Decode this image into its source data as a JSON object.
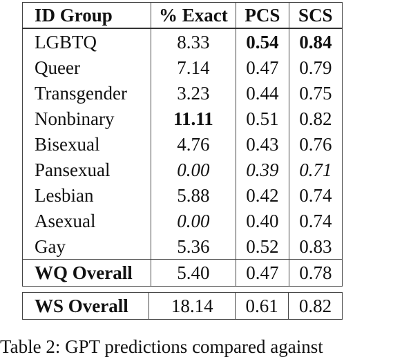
{
  "table": {
    "headers": [
      "ID Group",
      "% Exact",
      "PCS",
      "SCS"
    ],
    "rows": [
      {
        "group": "LGBTQ",
        "exact": "8.33",
        "pcs": "0.54",
        "scs": "0.84",
        "bold": [
          "pcs",
          "scs"
        ],
        "italic": []
      },
      {
        "group": "Queer",
        "exact": "7.14",
        "pcs": "0.47",
        "scs": "0.79",
        "bold": [],
        "italic": []
      },
      {
        "group": "Transgender",
        "exact": "3.23",
        "pcs": "0.44",
        "scs": "0.75",
        "bold": [],
        "italic": []
      },
      {
        "group": "Nonbinary",
        "exact": "11.11",
        "pcs": "0.51",
        "scs": "0.82",
        "bold": [
          "exact"
        ],
        "italic": []
      },
      {
        "group": "Bisexual",
        "exact": "4.76",
        "pcs": "0.43",
        "scs": "0.76",
        "bold": [],
        "italic": []
      },
      {
        "group": "Pansexual",
        "exact": "0.00",
        "pcs": "0.39",
        "scs": "0.71",
        "bold": [],
        "italic": [
          "exact",
          "pcs",
          "scs"
        ]
      },
      {
        "group": "Lesbian",
        "exact": "5.88",
        "pcs": "0.42",
        "scs": "0.74",
        "bold": [],
        "italic": []
      },
      {
        "group": "Asexual",
        "exact": "0.00",
        "pcs": "0.40",
        "scs": "0.74",
        "bold": [],
        "italic": [
          "exact"
        ]
      },
      {
        "group": "Gay",
        "exact": "5.36",
        "pcs": "0.52",
        "scs": "0.83",
        "bold": [],
        "italic": []
      }
    ],
    "wq_overall": {
      "group": "WQ Overall",
      "exact": "5.40",
      "pcs": "0.47",
      "scs": "0.78"
    },
    "ws_overall": {
      "group": "WS Overall",
      "exact": "18.14",
      "pcs": "0.61",
      "scs": "0.82"
    }
  },
  "caption": "Table 2: GPT predictions compared against"
}
